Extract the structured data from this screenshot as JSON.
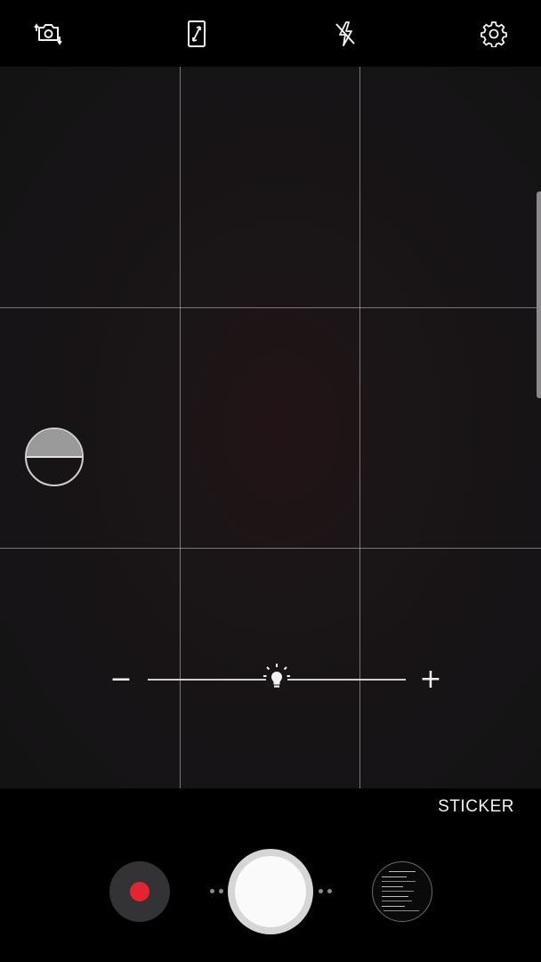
{
  "top_bar": {
    "icons": [
      "switch-camera-icon",
      "aspect-ratio-icon",
      "flash-off-icon",
      "settings-gear-icon"
    ]
  },
  "viewfinder": {
    "grid": "3x3",
    "mode_toggle_icon": "half-circle-mode-icon"
  },
  "exposure": {
    "minus_label": "−",
    "plus_label": "+",
    "thumb_icon": "light-bulb-icon",
    "level": 0.5
  },
  "bottom_bar": {
    "sticker_label": "STICKER",
    "record_icon": "record-video-icon",
    "shutter_icon": "shutter-icon",
    "gallery_icon": "gallery-thumbnail"
  },
  "colors": {
    "record_red": "#e3262d",
    "background": "#000000",
    "viewfinder": "#161416"
  }
}
